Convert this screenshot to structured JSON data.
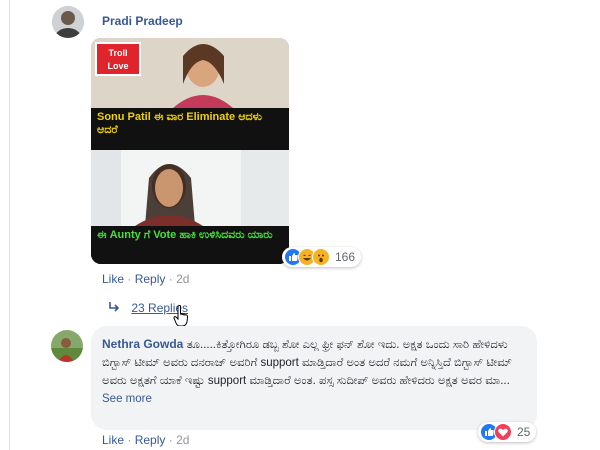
{
  "comment1": {
    "author": "Pradi Pradeep",
    "meme": {
      "badge_line1": "Troll",
      "badge_line2": "Love",
      "caption_top": "Sonu Patil ಈ ವಾರ Eliminate ಆದಳು ಆದರೆ",
      "caption_bottom": "ಈ Aunty ಗೆ Vote ಹಾಕಿ ಉಳಿಸಿದವರು ಯಾರು"
    },
    "actions": {
      "like": "Like",
      "reply": "Reply",
      "sep": "·",
      "time": "2d"
    },
    "reaction_count": "166",
    "replies": "23 Replies"
  },
  "comment2": {
    "author": "Nethra Gowda",
    "text": "ತೂ.....ಕಿತ್ತೋಗಿರೂ ಡಬ್ಬ ಶೋ ಎಲ್ಲ ಫ್ರೀ ಫನ್ ಶೋ ಇದು. ಅಕ್ಷತ ಒಂದು ಸಾರಿ ಹೇಳಿದಳು ಬಿಗ್ಬಾಸ್ ಟೀಮ್ ಅವರು ದನರಾಜ್ ಅವರಿಗೆ support ಮಾಡ್ತಿದಾರೆ ಅಂತ ಅದರೆ ನಮಗೆ ಅನ್ನಿಸ್ತಿದೆ ಬಿಗ್ಬಾಸ್ ಟೀಮ್ ಅವರು ಅಕ್ಷತಗೆ ಯಾಕೆ ಇಷ್ಟು support ಮಾಡ್ತಿದಾರೆ ಅಂತ. ಪಸ್ಸ ಸುದೀಪ್ ಅವರು ಹೇಳಿದರು ಅಕ್ಷತ ಅವರ ಮಾ...",
    "see_more": "See more",
    "actions": {
      "like": "Like",
      "reply": "Reply",
      "sep": "·",
      "time": "2d"
    },
    "reaction_count": "25"
  },
  "colors": {
    "link": "#385898",
    "muted": "#90949c",
    "like_blue": "#2078f4",
    "love_red": "#f33e58",
    "haha_yellow": "#f7b125",
    "bubble_bg": "#f2f3f5"
  }
}
